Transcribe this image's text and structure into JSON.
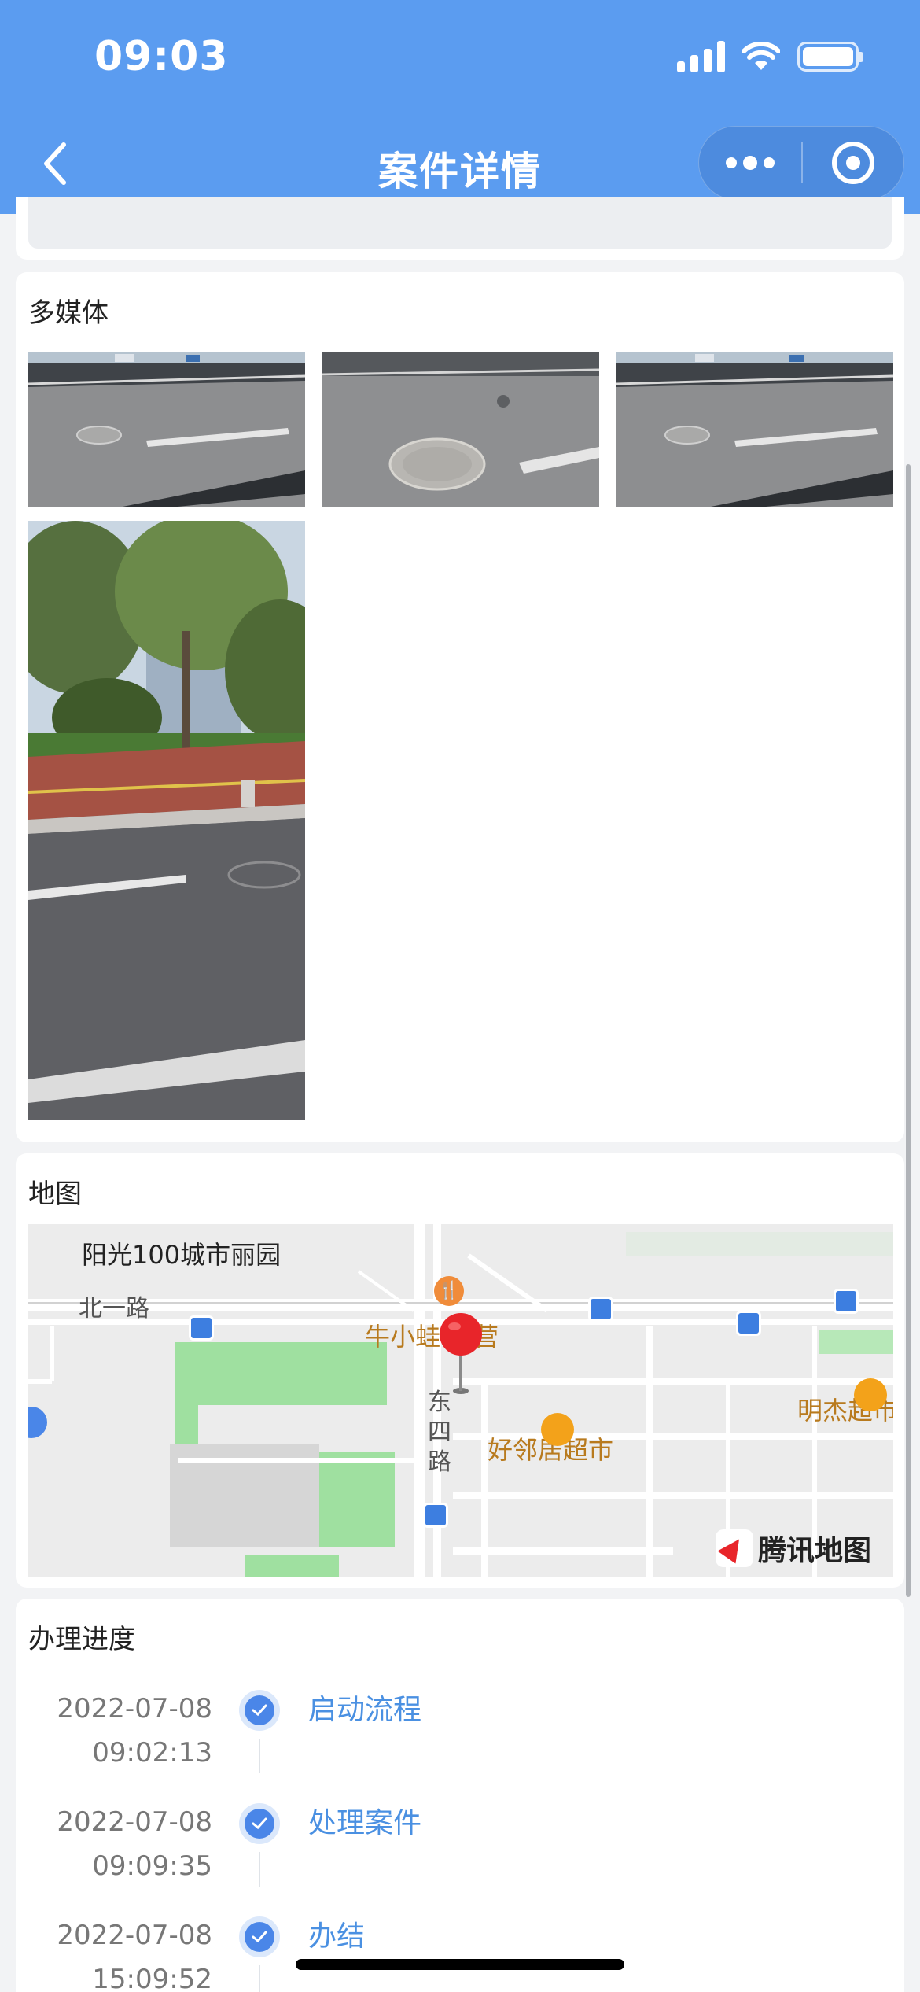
{
  "status_bar": {
    "time": "09:03"
  },
  "nav": {
    "title": "案件详情"
  },
  "media": {
    "title": "多媒体",
    "photos": [
      {
        "icon": "manhole-road-photo"
      },
      {
        "icon": "manhole-closeup-photo"
      },
      {
        "icon": "manhole-road-photo"
      },
      {
        "icon": "street-trees-photo"
      }
    ]
  },
  "map": {
    "title": "地图",
    "labels": {
      "community": "阳光100城市丽园",
      "road_north": "北一路",
      "restaurant": "牛小蛙·东营",
      "road_east_west": "东四路",
      "supermarket1": "好邻居超市",
      "supermarket2": "明杰超市",
      "brand": "腾讯地图"
    },
    "icons": [
      "location-pin-icon",
      "bus-stop-icon",
      "restaurant-icon",
      "shop-icon",
      "tencent-map-logo"
    ]
  },
  "progress": {
    "title": "办理进度",
    "steps": [
      {
        "date": "2022-07-08",
        "time": "09:02:13",
        "label": "启动流程"
      },
      {
        "date": "2022-07-08",
        "time": "09:09:35",
        "label": "处理案件"
      },
      {
        "date": "2022-07-08",
        "time": "15:09:52",
        "label": "办结"
      }
    ]
  },
  "colors": {
    "header": "#5b9cf0",
    "step_link": "#4a90e2",
    "timeline_dot": "#4a86e8",
    "map_marker": "#e8252a",
    "map_poi_text": "#b87a1e"
  }
}
